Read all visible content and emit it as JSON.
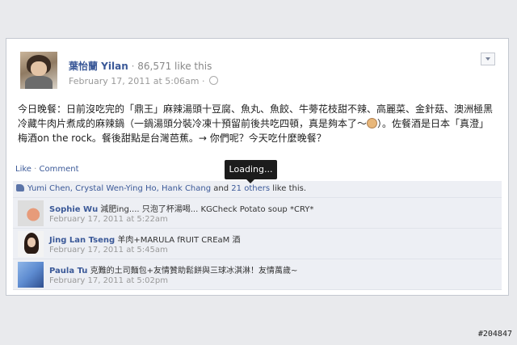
{
  "post": {
    "author_name": "葉怡蘭 Yilan",
    "separator": "·",
    "author_likes": "86,571 like this",
    "timestamp": "February 17, 2011 at 5:06am",
    "timestamp_sep": "·",
    "text_part1": "今日晚餐：日前沒吃完的「鼎王」麻辣湯頭十豆腐、魚丸、魚餃、牛蒡花枝甜不辣、高麗菜、金針菇、澳洲極黑冷藏牛肉片煮成的麻辣鍋（一鍋湯頭分裝冷凍十預留前後共吃四頓，真是夠本了～",
    "text_part2": "）。佐餐酒是日本「真澄」梅酒on the rock。餐後甜點是台灣芭蕉。→ 你們呢？今天吃什麼晚餐？"
  },
  "actions": {
    "like": "Like",
    "dot": "·",
    "comment": "Comment"
  },
  "tooltip": {
    "text": "Loading..."
  },
  "likes": {
    "names": "Yumi Chen, Crystal Wen-Ying Ho, Hank Chang",
    "and": "and",
    "others": "21 others",
    "suffix": "like this."
  },
  "comments": [
    {
      "name": "Sophie Wu",
      "text": "減肥ing.... 只泡了杯湯喝... KGCheck Potato soup *CRY*",
      "time": "February 17, 2011 at 5:22am"
    },
    {
      "name": "Jing Lan Tseng",
      "text": "羊肉+MARULA fRUIT CREaM 酒",
      "time": "February 17, 2011 at 5:45am"
    },
    {
      "name": "Paula Tu",
      "text": "克難的土司麵包+友情贊助鬆餅與三球冰淇淋！友情萬歲~",
      "time": "February 17, 2011 at 5:02pm"
    }
  ],
  "watermark": "#204847",
  "icons": [
    "chevron-down-icon",
    "globe-icon",
    "thumbs-up-icon",
    "emoji-icon"
  ]
}
